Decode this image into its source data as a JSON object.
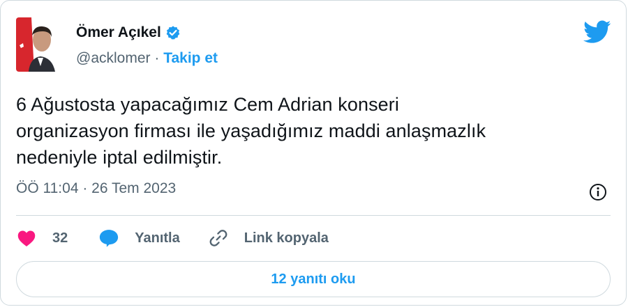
{
  "author": {
    "name": "Ömer Açıkel",
    "handle": "@acklomer",
    "separator": "·",
    "follow_label": "Takip et",
    "verified": true
  },
  "tweet": {
    "text_lines": [
      "6 Ağustosta yapacağımız Cem Adrian konseri",
      "organizasyon firması ile yaşadığımız maddi anlaşmazlık",
      "nedeniyle iptal edilmiştir."
    ],
    "timestamp": "ÖÖ 11:04 · 26 Tem 2023"
  },
  "actions": {
    "like_count": "32",
    "reply_label": "Yanıtla",
    "copy_link_label": "Link kopyala"
  },
  "replies_button_label": "12 yanıtı oku",
  "colors": {
    "accent": "#1d9bf0",
    "like": "#f91880",
    "text": "#0f1419",
    "muted": "#536471",
    "border": "#cfd9de"
  },
  "icons": [
    "avatar",
    "verified-badge-icon",
    "twitter-bird-icon",
    "info-icon",
    "heart-icon",
    "reply-bubble-icon",
    "link-icon"
  ]
}
